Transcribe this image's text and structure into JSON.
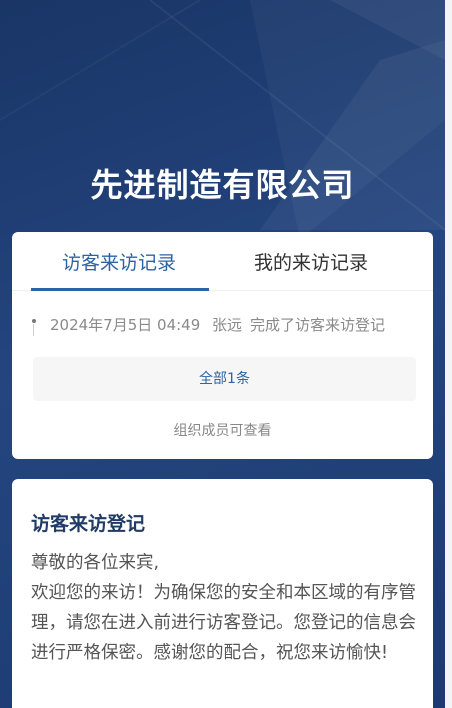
{
  "company": {
    "name": "先进制造有限公司"
  },
  "tabs": [
    {
      "label": "访客来访记录",
      "active": true
    },
    {
      "label": "我的来访记录",
      "active": false
    }
  ],
  "records": [
    {
      "time": "2024年7月5日 04:49",
      "name": "张远",
      "action": "完成了访客来访登记"
    }
  ],
  "all_button_label": "全部1条",
  "members_note": "组织成员可查看",
  "register": {
    "title": "访客来访登记",
    "greeting": "尊敬的各位来宾,",
    "message": "欢迎您的来访！为确保您的安全和本区域的有序管理，请您在进入前进行访客登记。您登记的信息会进行严格保密。感谢您的配合，祝您来访愉快!"
  },
  "colors": {
    "background": "#1f3e75",
    "accent": "#2e63a3",
    "title_dark": "#1f3b66"
  }
}
